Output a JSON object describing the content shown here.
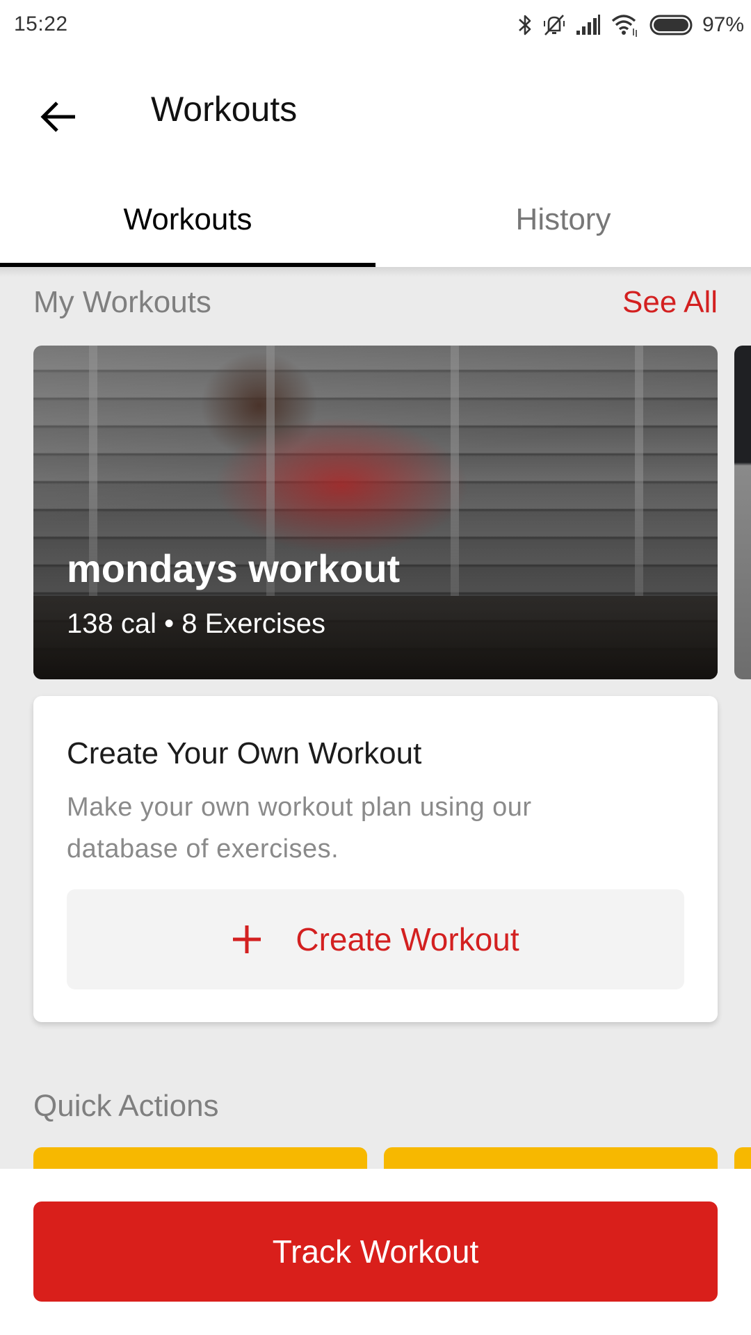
{
  "status_bar": {
    "time": "15:22",
    "icons": [
      "bluetooth-icon",
      "bell-off-icon",
      "signal-icon",
      "wifi-icon",
      "battery-icon"
    ],
    "battery_percent": "97%"
  },
  "app_bar": {
    "back_icon": "arrow-left-icon",
    "title": "Workouts"
  },
  "tabs": [
    {
      "label": "Workouts",
      "active": true
    },
    {
      "label": "History",
      "active": false
    }
  ],
  "my_workouts": {
    "title": "My Workouts",
    "see_all_label": "See All",
    "cards": [
      {
        "name": "mondays workout",
        "meta": "138 cal • 8 Exercises"
      }
    ]
  },
  "create_card": {
    "title": "Create Your Own Workout",
    "description": "Make your own workout plan using our database of exercises.",
    "button_icon": "plus-icon",
    "button_label": "Create Workout"
  },
  "quick_actions": {
    "title": "Quick Actions"
  },
  "bottom": {
    "track_label": "Track Workout"
  },
  "colors": {
    "accent_red": "#d91f1b",
    "quick_action_yellow": "#f7b800"
  }
}
